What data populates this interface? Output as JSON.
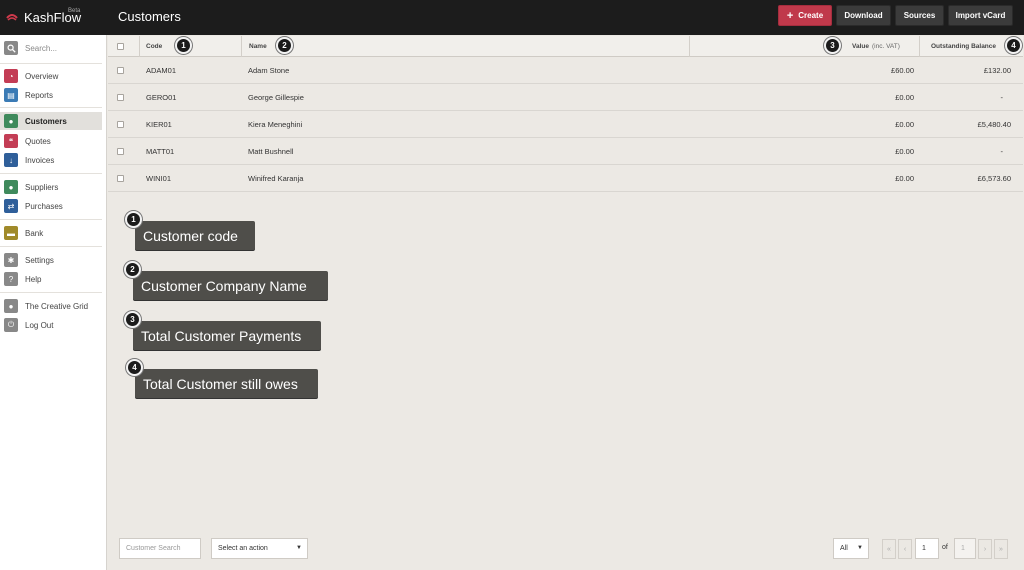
{
  "app": {
    "name": "KashFlow",
    "badge": "Beta"
  },
  "header": {
    "title": "Customers",
    "buttons": {
      "create": "Create",
      "download": "Download",
      "sources": "Sources",
      "import_vcard": "Import vCard"
    }
  },
  "sidebar": {
    "search_placeholder": "Search...",
    "items": [
      {
        "label": "Overview",
        "icon": "speedometer-icon",
        "color": "#c33d55"
      },
      {
        "label": "Reports",
        "icon": "chart-icon",
        "color": "#3b7bb5"
      },
      {
        "label": "Customers",
        "icon": "people-icon",
        "color": "#3f8a5c"
      },
      {
        "label": "Quotes",
        "icon": "quote-icon",
        "color": "#c33d55"
      },
      {
        "label": "Invoices",
        "icon": "invoice-icon",
        "color": "#2f5f9a"
      },
      {
        "label": "Suppliers",
        "icon": "suppliers-icon",
        "color": "#3f8a5c"
      },
      {
        "label": "Purchases",
        "icon": "purchases-icon",
        "color": "#2f5f9a"
      },
      {
        "label": "Bank",
        "icon": "bank-icon",
        "color": "#a08a2a"
      },
      {
        "label": "Settings",
        "icon": "gear-icon",
        "color": "#888888"
      },
      {
        "label": "Help",
        "icon": "help-icon",
        "color": "#888888"
      },
      {
        "label": "The Creative Grid",
        "icon": "user-icon",
        "color": "#888888"
      },
      {
        "label": "Log Out",
        "icon": "power-icon",
        "color": "#888888"
      }
    ]
  },
  "table": {
    "headers": {
      "code": "Code",
      "name": "Name",
      "value": "Value",
      "value_note": "(inc. VAT)",
      "balance": "Outstanding Balance"
    },
    "rows": [
      {
        "code": "ADAM01",
        "name": "Adam Stone",
        "value": "£60.00",
        "balance": "£132.00"
      },
      {
        "code": "GERO01",
        "name": "George Gillespie",
        "value": "£0.00",
        "balance": "-"
      },
      {
        "code": "KIER01",
        "name": "Kiera Meneghini",
        "value": "£0.00",
        "balance": "£5,480.40"
      },
      {
        "code": "MATT01",
        "name": "Matt Bushnell",
        "value": "£0.00",
        "balance": "-"
      },
      {
        "code": "WINI01",
        "name": "Winifred Karanja",
        "value": "£0.00",
        "balance": "£6,573.60"
      }
    ]
  },
  "markers": [
    "1",
    "2",
    "3",
    "4"
  ],
  "annotations": [
    {
      "num": "1",
      "text": "Customer code"
    },
    {
      "num": "2",
      "text": "Customer Company Name"
    },
    {
      "num": "3",
      "text": "Total Customer Payments"
    },
    {
      "num": "4",
      "text": "Total Customer still owes"
    }
  ],
  "footer": {
    "search_placeholder": "Customer Search",
    "action_select": "Select an action",
    "page_size": "All",
    "page_current": "1",
    "of_label": "of",
    "page_total": "1"
  }
}
